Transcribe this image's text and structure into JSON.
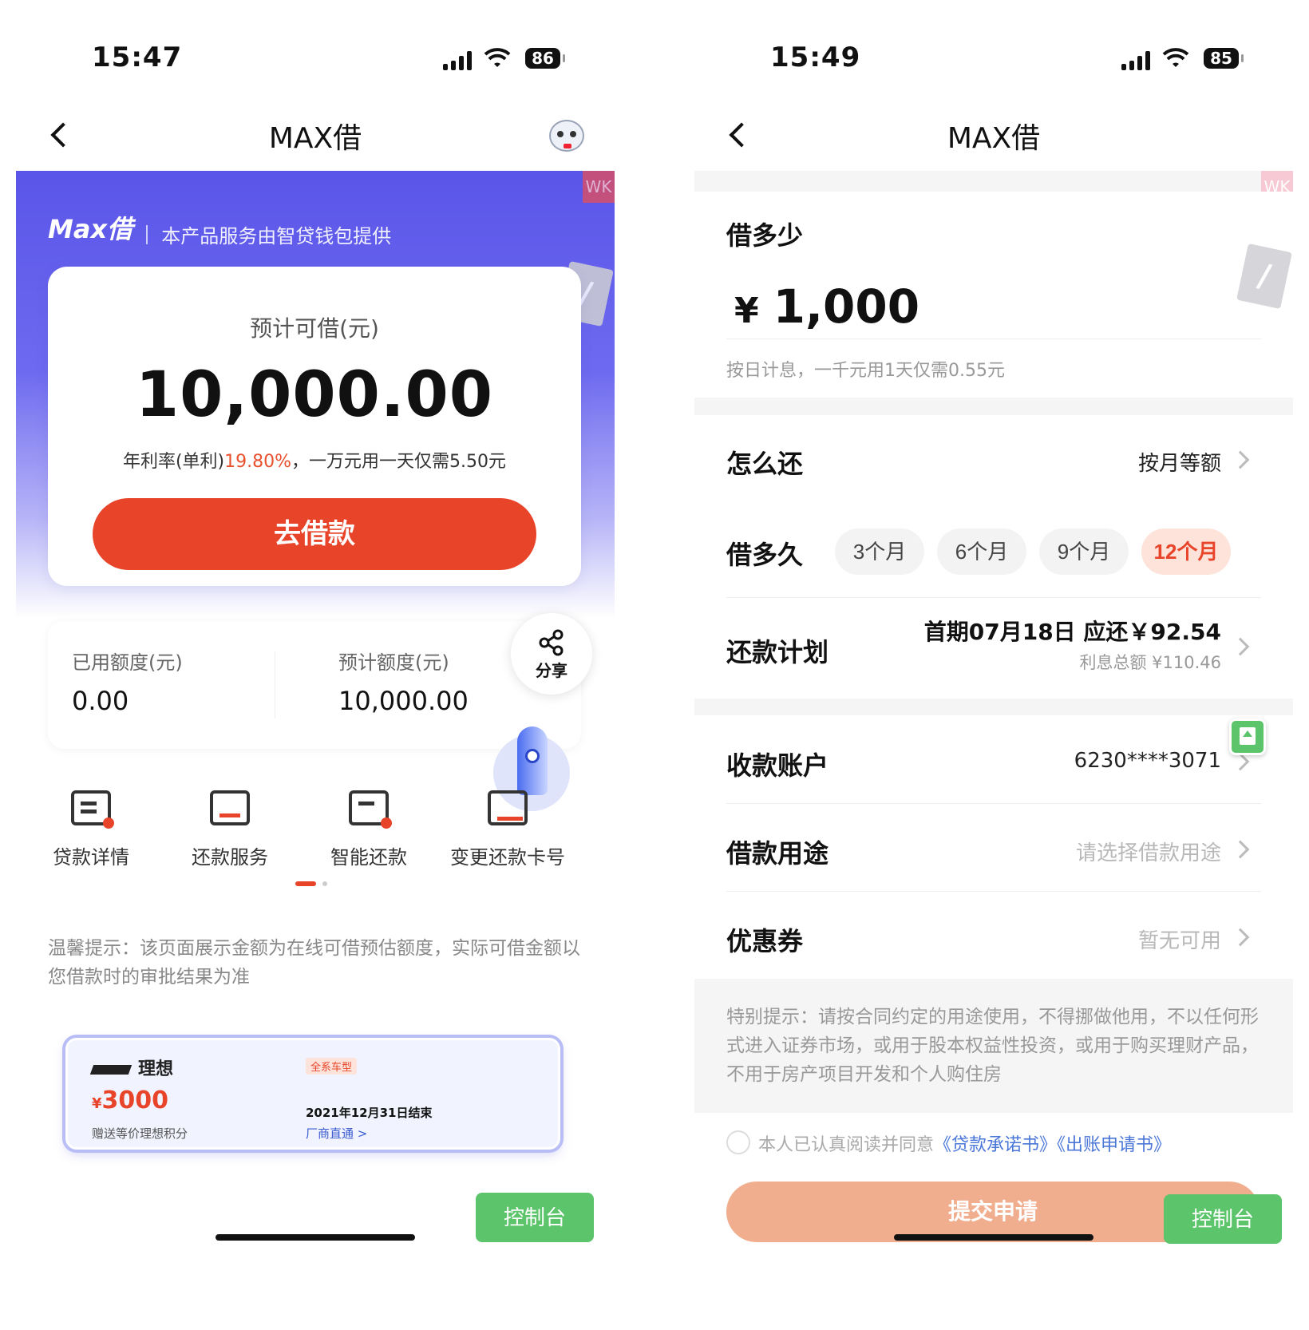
{
  "left": {
    "status": {
      "time": "15:47",
      "battery": "86"
    },
    "nav": {
      "title": "MAX借"
    },
    "brand": {
      "logo": "Max借",
      "desc": "本产品服务由智贷钱包提供",
      "watermark": "WK"
    },
    "loan_card": {
      "label": "预计可借(元)",
      "amount": "10,000.00",
      "rate_prefix": "年利率(单利)",
      "rate_value": "19.80%",
      "rate_suffix": "，一万元用一天仅需5.50元",
      "button": "去借款"
    },
    "quota": {
      "used_label": "已用额度(元)",
      "used_value": "0.00",
      "est_label": "预计额度(元)",
      "est_value": "10,000.00"
    },
    "share": {
      "label": "分享",
      "icon": "share-icon"
    },
    "menu": [
      {
        "label": "贷款详情",
        "icon": "loan-detail-icon"
      },
      {
        "label": "还款服务",
        "icon": "repay-service-icon"
      },
      {
        "label": "智能还款",
        "icon": "smart-repay-icon"
      },
      {
        "label": "变更还款卡号",
        "icon": "change-card-icon"
      }
    ],
    "tip": "温馨提示：该页面展示金额为在线可借预估额度，实际可借金额以您借款时的审批结果为准",
    "ad": {
      "brand": "理想",
      "tag": "全系车型",
      "currency": "¥",
      "price": "3000",
      "sub": "赠送等价理想积分",
      "date": "2021年12月31日结束",
      "link": "厂商直通 >"
    },
    "console": "控制台"
  },
  "right": {
    "status": {
      "time": "15:49",
      "battery": "85"
    },
    "nav": {
      "title": "MAX借"
    },
    "watermark": "WK",
    "amount": {
      "label": "借多少",
      "currency": "¥",
      "value": "1,000",
      "note": "按日计息，一千元用1天仅需0.55元"
    },
    "repay_method": {
      "label": "怎么还",
      "value": "按月等额"
    },
    "term": {
      "label": "借多久",
      "options": [
        "3个月",
        "6个月",
        "9个月",
        "12个月"
      ],
      "selected": "12个月"
    },
    "plan": {
      "label": "还款计划",
      "first": "首期07月18日 应还￥92.54",
      "interest": "利息总额 ¥110.46"
    },
    "account": {
      "label": "收款账户",
      "value": "6230****3071"
    },
    "purpose": {
      "label": "借款用途",
      "placeholder": "请选择借款用途"
    },
    "coupon": {
      "label": "优惠券",
      "value": "暂无可用"
    },
    "notice": "特别提示：请按合同约定的用途使用，不得挪做他用，不以任何形式进入证券市场，或用于股本权益性投资，或用于购买理财产品，不用于房产项目开发和个人购住房",
    "agree": {
      "prefix": "本人已认真阅读并同意",
      "doc1": "《贷款承诺书》",
      "doc2": "《出账申请书》"
    },
    "submit": "提交申请",
    "console": "控制台"
  },
  "colors": {
    "brand": "#5a55e8",
    "accent": "#e8442a",
    "console": "#5cc46a"
  }
}
